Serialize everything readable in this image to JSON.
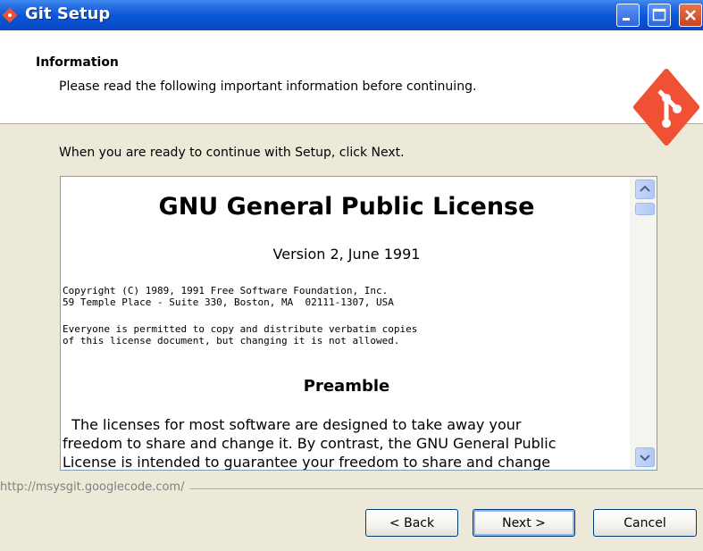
{
  "window": {
    "title": "Git Setup",
    "icon": "git-icon",
    "buttons": [
      "minimize-icon",
      "maximize-icon",
      "close-icon"
    ]
  },
  "header": {
    "title": "Information",
    "subtitle": "Please read the following important information before continuing.",
    "logo": "git-logo-icon",
    "logo_color": "#f05033"
  },
  "intro_text": "When you are ready to continue with Setup, click Next.",
  "license": {
    "title": "GNU General Public License",
    "version": "Version 2, June 1991",
    "copyright_lines": [
      "Copyright (C) 1989, 1991 Free Software Foundation, Inc.",
      "59 Temple Place - Suite 330, Boston, MA  02111-1307, USA"
    ],
    "permission_lines": [
      "Everyone is permitted to copy and distribute verbatim copies",
      "of this license document, but changing it is not allowed."
    ],
    "preamble_title": "Preamble",
    "preamble_lines": [
      "  The licenses for most software are designed to take away your",
      "freedom to share and change it. By contrast, the GNU General Public",
      "License is intended to guarantee your freedom to share and change"
    ]
  },
  "footer": {
    "url_label": "http://msysgit.googlecode.com/",
    "back_label": "< Back",
    "next_label": "Next >",
    "cancel_label": "Cancel"
  },
  "colors": {
    "titlebar": "#0a56d8",
    "dialog_bg": "#ece9d8",
    "button_border": "#003c74"
  }
}
